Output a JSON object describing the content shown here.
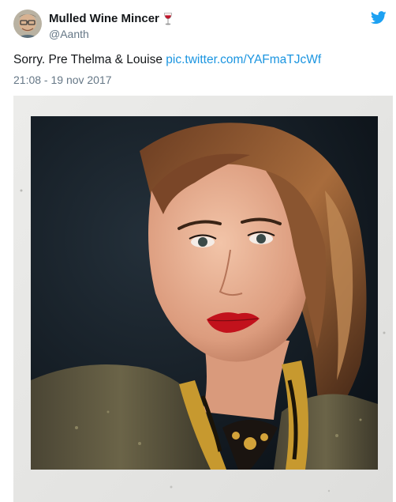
{
  "tweet": {
    "display_name": "Mulled Wine Mincer",
    "name_emoji_icon": "wine-glass-icon",
    "handle": "@Aanth",
    "text_prefix": "Sorry. Pre Thelma & Louise ",
    "link": "pic.twitter.com/YAFmaTJcWf",
    "timestamp": "21:08 - 19 nov 2017",
    "brand_icon": "twitter-bird-icon",
    "brand_color": "#1da1f2",
    "link_color": "#1b95e0",
    "secondary_text_color": "#657786"
  }
}
